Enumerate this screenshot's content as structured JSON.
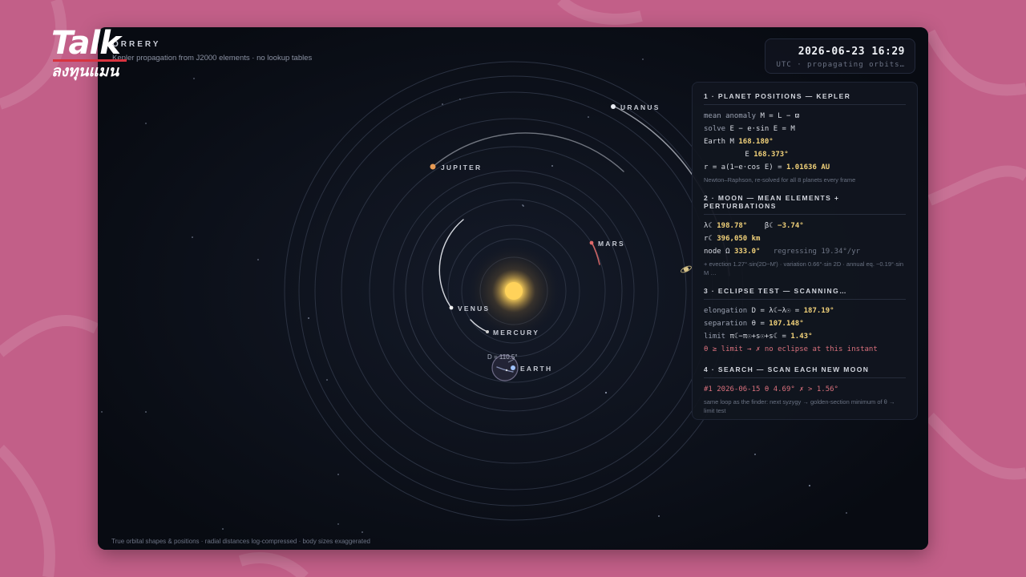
{
  "brand": {
    "name": "Talk",
    "sub": "ลงทุนแมน"
  },
  "header": {
    "title": "ORRERY",
    "subtitle": "Kepler propagation from J2000 elements · no lookup tables"
  },
  "clock": {
    "datetime": "2026-06-23 16:29",
    "status": "UTC · propagating orbits…"
  },
  "planets": {
    "uranus": "URANUS",
    "jupiter": "JUPITER",
    "mars": "MARS",
    "venus": "VENUS",
    "mercury": "MERCURY",
    "earth": "EARTH"
  },
  "earth_marker": "D = 110.5°",
  "panel": {
    "s1": {
      "title": "1 · PLANET POSITIONS — KEPLER",
      "mean_anomaly_label": "mean anomaly",
      "mean_anomaly_eq": "M = L − ϖ",
      "solve_label": "solve",
      "solve_eq": "E − e·sin E = M",
      "earth_label": "Earth",
      "m_label": "M",
      "m_value": "168.180°",
      "e_label": "E",
      "e_value": "168.373°",
      "r_eq": "r = a(1−e·cos E) =",
      "r_value": "1.01636 AU",
      "note": "Newton–Raphson, re-solved for all 8 planets every frame"
    },
    "s2": {
      "title": "2 · MOON — MEAN ELEMENTS + PERTURBATIONS",
      "lambda_label": "λ☾",
      "lambda_value": "198.78°",
      "beta_label": "β☾",
      "beta_value": "−3.74°",
      "r_label": "r☾",
      "r_value": "396,050 km",
      "node_label": "node Ω",
      "node_value": "333.0°",
      "node_note": "regressing 19.34°/yr",
      "note": "+ evection 1.27°·sin(2D−M′) · variation 0.66°·sin 2D · annual eq. −0.19°·sin M …"
    },
    "s3": {
      "title": "3 · ECLIPSE TEST — SCANNING…",
      "elong_label": "elongation",
      "elong_eq": "D = λ☾−λ☉ =",
      "elong_value": "187.19°",
      "sep_label": "separation",
      "sep_eq": "θ =",
      "sep_value": "107.148°",
      "limit_label": "limit",
      "limit_eq": "π☾−π☉+s☉+s☾ =",
      "limit_value": "1.43°",
      "result": "θ ≥ limit  →  ✗ no eclipse at this instant"
    },
    "s4": {
      "title": "4 · SEARCH — SCAN EACH NEW MOON",
      "row": "#1  2026-06-15  θ 4.69°  ✗ > 1.56°",
      "note": "same loop as the finder: next syzygy → golden-section minimum of θ → limit test"
    }
  },
  "footer": "True orbital shapes & positions · radial distances log-compressed · body sizes exaggerated",
  "colors": {
    "page_bg": "#c25f88",
    "window_bg": "#0a0e16",
    "value": "#f2d27a",
    "alert": "#d9707c",
    "sun": "#ffd25a"
  }
}
